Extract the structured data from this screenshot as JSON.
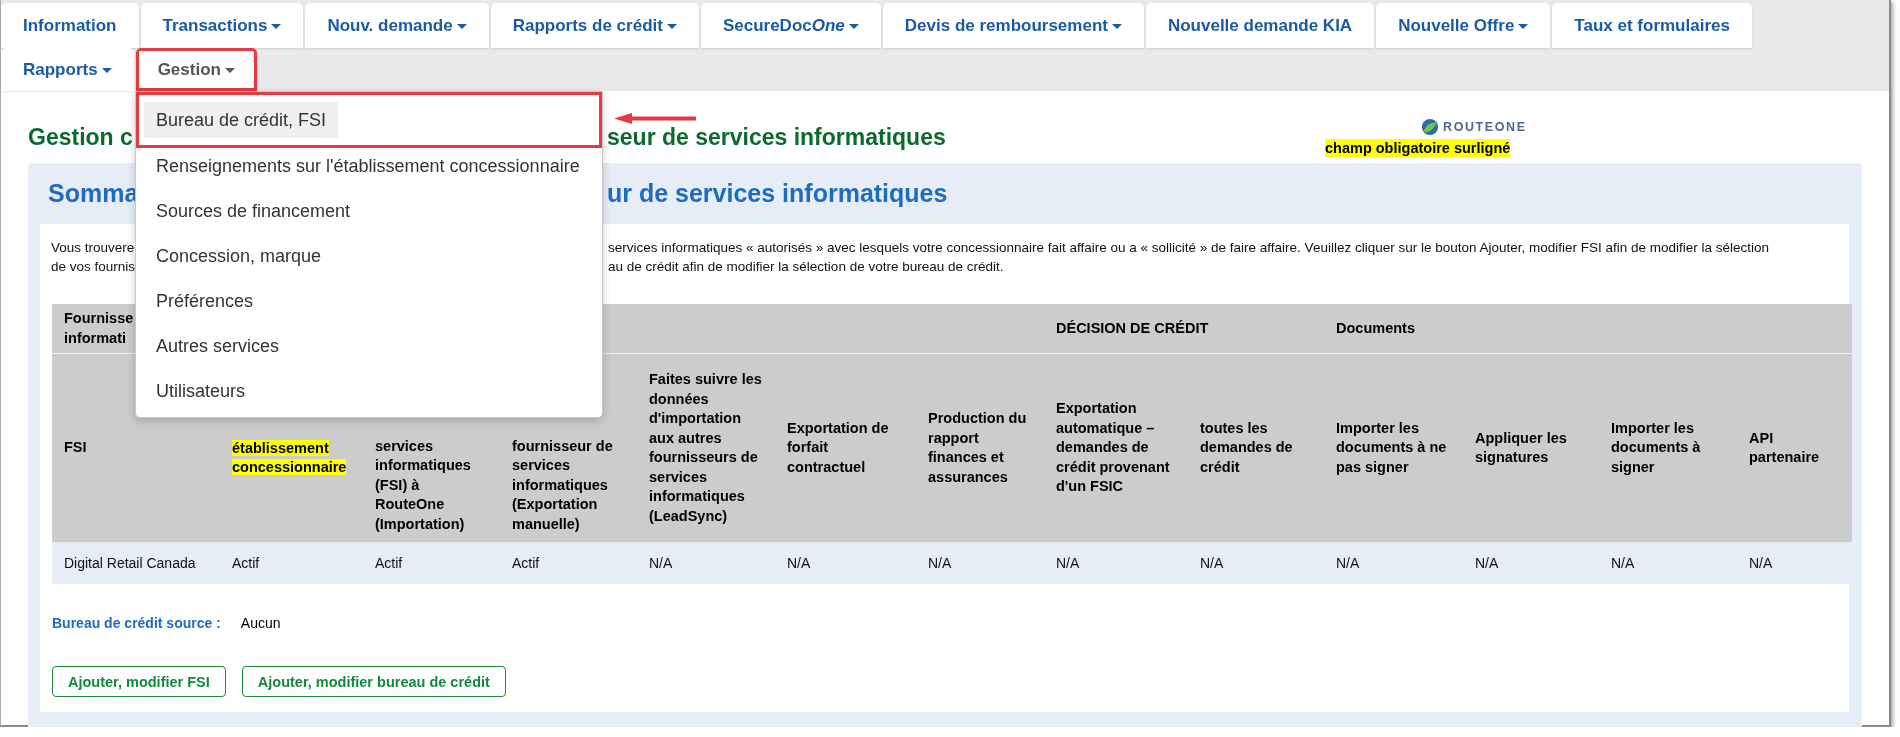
{
  "nav": {
    "rows": [
      {
        "tabs": [
          {
            "label": "Information",
            "has_menu": false,
            "selected": false,
            "callout": false
          },
          {
            "label": "Transactions",
            "has_menu": true,
            "selected": false,
            "callout": false
          },
          {
            "label": "Nouv. demande",
            "has_menu": true,
            "selected": false,
            "callout": false
          },
          {
            "label": "Rapports de crédit",
            "has_menu": true,
            "selected": false,
            "callout": false
          },
          {
            "label": "SecureDoc",
            "italic_suffix": "One",
            "has_menu": true,
            "selected": false,
            "callout": false
          },
          {
            "label": "Devis de remboursement",
            "has_menu": true,
            "selected": false,
            "callout": false
          },
          {
            "label": "Nouvelle demande KIA",
            "has_menu": false,
            "selected": false,
            "callout": false
          },
          {
            "label": "Nouvelle Offre",
            "has_menu": true,
            "selected": false,
            "callout": false
          },
          {
            "label": "Taux et formulaires",
            "has_menu": false,
            "selected": false,
            "callout": false
          }
        ]
      },
      {
        "tabs": [
          {
            "label": "Rapports",
            "has_menu": true,
            "selected": false,
            "callout": false
          },
          {
            "label": "Gestion",
            "has_menu": true,
            "selected": true,
            "callout": true
          }
        ]
      }
    ]
  },
  "menu": {
    "items": [
      {
        "label": "Bureau de crédit, FSI",
        "selected": true,
        "callout": true
      },
      {
        "label": "Renseignements sur l'établissement concessionnaire",
        "selected": false,
        "callout": false
      },
      {
        "label": "Sources de financement",
        "selected": false,
        "callout": false
      },
      {
        "label": "Concession, marque",
        "selected": false,
        "callout": false
      },
      {
        "label": "Préférences",
        "selected": false,
        "callout": false
      },
      {
        "label": "Autres services",
        "selected": false,
        "callout": false
      },
      {
        "label": "Utilisateurs",
        "selected": false,
        "callout": false
      }
    ]
  },
  "page": {
    "title_parts": [
      "Gestion c",
      "seur de services informatiques"
    ],
    "logo": "ROUTEONE",
    "required_note": "champ obligatoire surligné"
  },
  "summary": {
    "heading_parts": [
      "Somma",
      "ur de services informatiques"
    ],
    "text_lines": [
      [
        "Vous trouvere",
        "services informatiques « autorisés » avec lesquels votre concessionnaire fait affaire ou a « sollicité » de faire affaire. Veuillez cliquer sur le bouton Ajouter, modifier FSI afin de modifier la sélection"
      ],
      [
        "de vos fournis",
        "au de crédit afin de modifier la sélection de votre bureau de crédit."
      ]
    ],
    "table": {
      "columns": [
        {
          "group": [
            "Fournisse",
            "informati"
          ],
          "lines": [
            "FSI"
          ],
          "highlighted": false
        },
        {
          "lines": [
            "établissement",
            "concessionnaire"
          ],
          "highlighted": true
        },
        {
          "lines": [
            "services",
            "informatiques",
            "(FSI) à",
            "RouteOne",
            "(Importation)"
          ],
          "highlighted": false
        },
        {
          "lines": [
            "fournisseur de",
            "services",
            "informatiques",
            "(Exportation",
            "manuelle)"
          ],
          "highlighted": false
        },
        {
          "lines": [
            "Faites suivre les",
            "données",
            "d'importation",
            "aux autres",
            "fournisseurs de",
            "services",
            "informatiques",
            "(LeadSync)"
          ],
          "highlighted": false
        },
        {
          "lines": [
            "Exportation de",
            "forfait",
            "contractuel"
          ],
          "highlighted": false
        },
        {
          "lines": [
            "Production du",
            "rapport",
            "finances et",
            "assurances"
          ],
          "highlighted": false
        },
        {
          "group": [
            "DÉCISION DE CRÉDIT"
          ],
          "lines": [
            "Exportation",
            "automatique –",
            "demandes de",
            "crédit provenant",
            "d'un FSIC"
          ],
          "highlighted": false
        },
        {
          "lines": [
            "toutes les",
            "demandes de",
            "crédit"
          ],
          "highlighted": false
        },
        {
          "group": [
            "Documents"
          ],
          "lines": [
            "Importer les",
            "documents à ne",
            "pas signer"
          ],
          "highlighted": false
        },
        {
          "lines": [
            "Appliquer les",
            "signatures"
          ],
          "highlighted": false
        },
        {
          "lines": [
            "Importer les",
            "documents à",
            "signer"
          ],
          "highlighted": false
        },
        {
          "lines": [
            "API partenaire"
          ],
          "highlighted": false
        }
      ],
      "rows": [
        {
          "cells": [
            "Digital Retail Canada",
            "Actif",
            "Actif",
            "Actif",
            "N/A",
            "N/A",
            "N/A",
            "N/A",
            "N/A",
            "N/A",
            "N/A",
            "N/A",
            "N/A"
          ]
        }
      ]
    },
    "source_label": "Bureau de crédit source :",
    "source_value": "Aucun",
    "buttons": [
      "Ajouter, modifier FSI",
      "Ajouter, modifier bureau de crédit"
    ]
  }
}
